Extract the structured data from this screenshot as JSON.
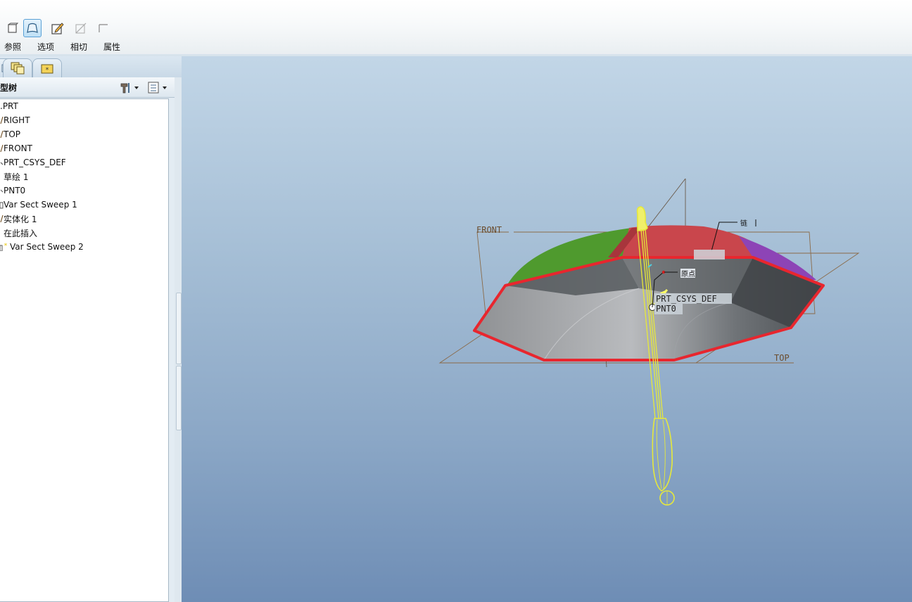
{
  "dashboard": {
    "tabs": [
      {
        "label": "参照"
      },
      {
        "label": "选项"
      },
      {
        "label": "相切"
      },
      {
        "label": "属性"
      }
    ]
  },
  "model_tree": {
    "title": "型树",
    "items": [
      {
        "label": ".PRT",
        "icon": "part-icon"
      },
      {
        "label": "RIGHT",
        "icon": "datum-plane-icon"
      },
      {
        "label": "TOP",
        "icon": "datum-plane-icon"
      },
      {
        "label": "FRONT",
        "icon": "datum-plane-icon"
      },
      {
        "label": "PRT_CSYS_DEF",
        "icon": "csys-icon"
      },
      {
        "label": "草绘 1",
        "icon": "sketch-icon"
      },
      {
        "label": "PNT0",
        "icon": "datum-point-icon"
      },
      {
        "label": "Var Sect Sweep 1",
        "icon": "sweep-icon"
      },
      {
        "label": "实体化 1",
        "icon": "solidify-icon"
      },
      {
        "label": "在此插入",
        "icon": "insert-here-icon"
      },
      {
        "label": "Var Sect Sweep 2",
        "icon": "sweep-icon"
      }
    ]
  },
  "viewport": {
    "datum_labels": {
      "front": "FRONT",
      "top": "TOP",
      "csys": "PRT_CSYS_DEF",
      "point": "PNT0",
      "origin_tag": "原点",
      "chain_tag": "链"
    },
    "colors": {
      "canopy_red": "#c9464c",
      "canopy_green": "#4f9a2e",
      "canopy_purple": "#8d44b6",
      "edge_highlight": "#e8262e",
      "handle_yellow": "#e7e93a",
      "datum_brown": "#8a6a48"
    }
  }
}
